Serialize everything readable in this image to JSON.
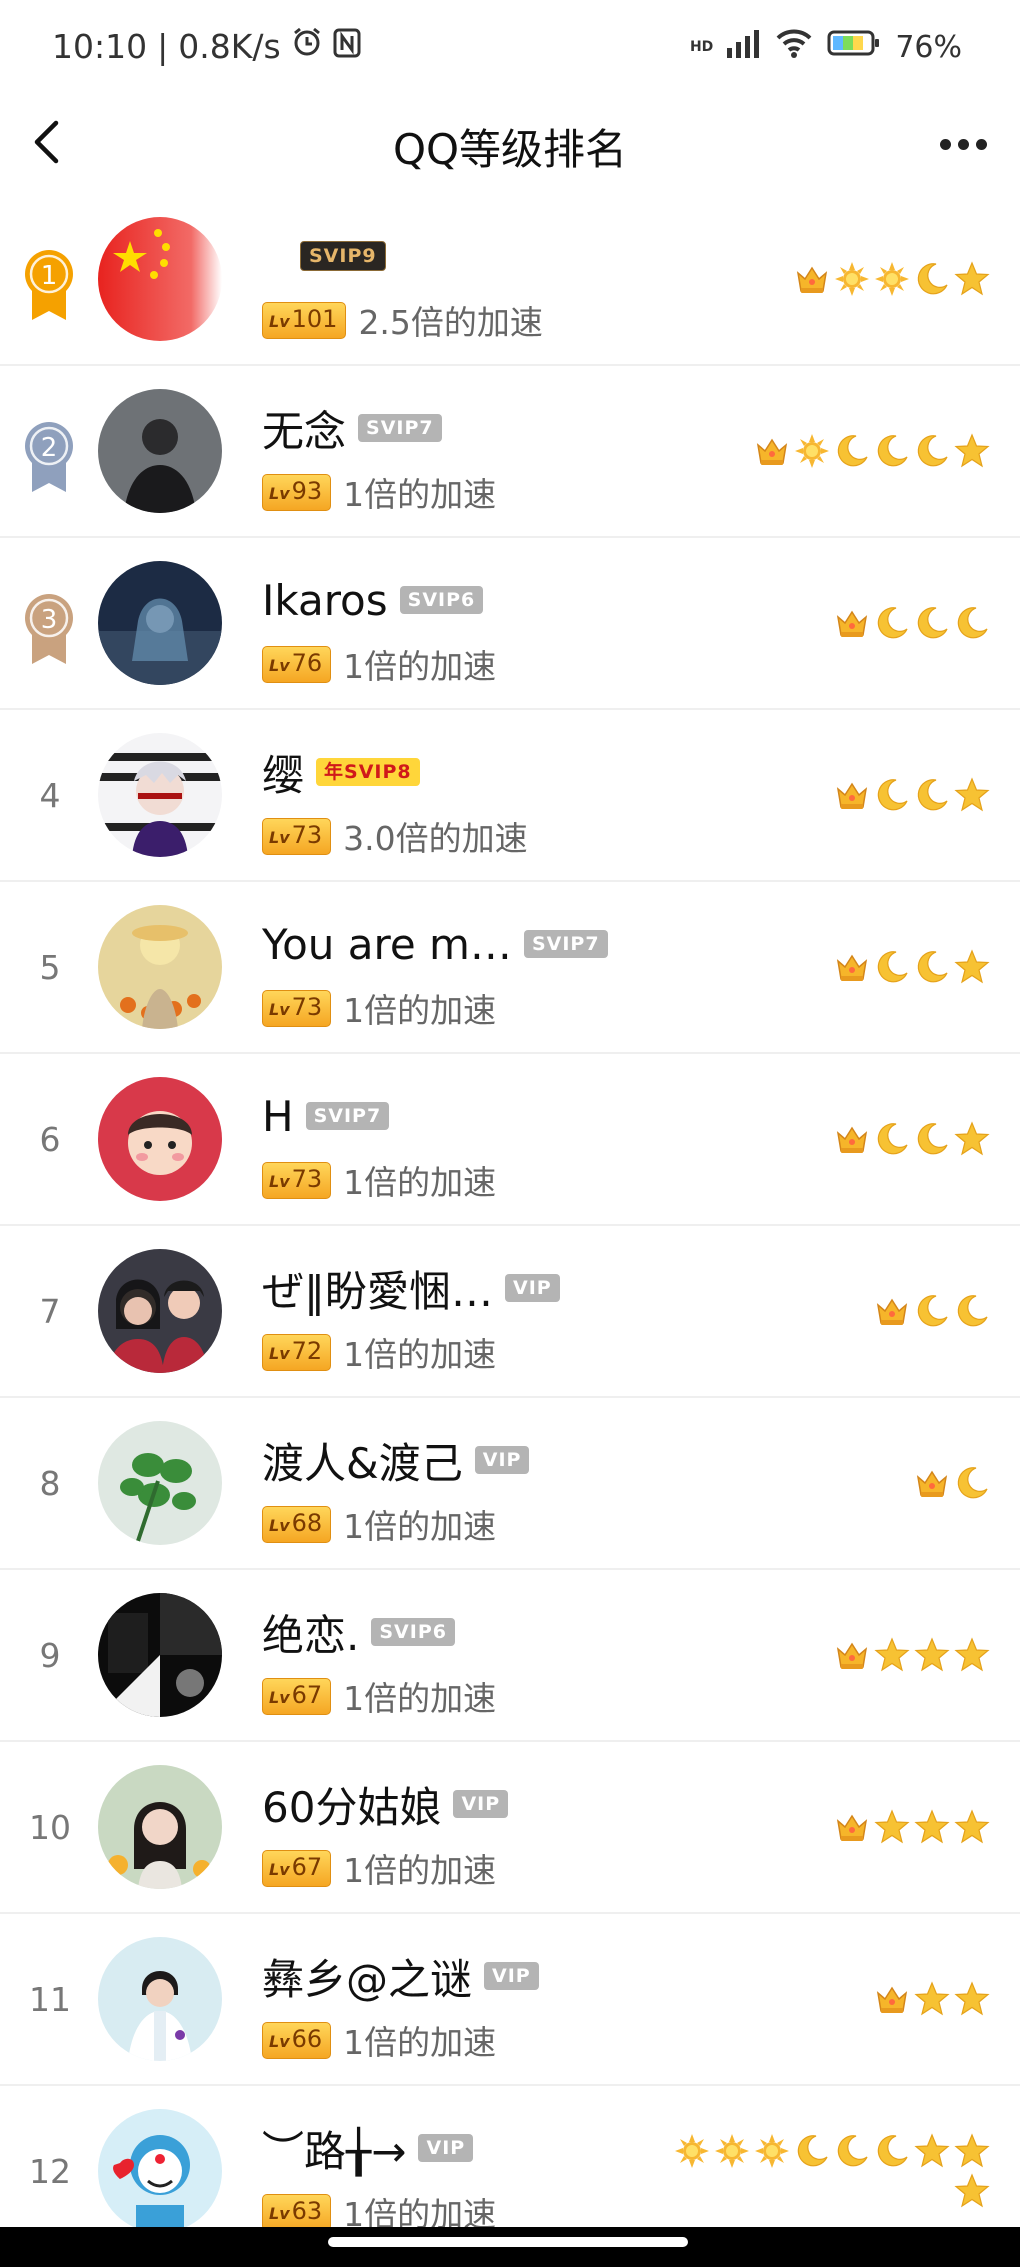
{
  "status_bar": {
    "time": "10:10",
    "separator": "|",
    "net_speed": "0.8K/s",
    "network_tag": "HD",
    "battery": "76%",
    "icons": [
      "alarm-icon",
      "nfc-icon",
      "signal-icon",
      "wifi-icon",
      "battery-icon"
    ]
  },
  "nav": {
    "back_icon": "chevron-left-icon",
    "title": "QQ等级排名",
    "more_icon": "more-dots-icon"
  },
  "colors": {
    "gold_medal": "#f5a100",
    "silver_medal": "#8fa0bd",
    "bronze_medal": "#c9a27f",
    "level_badge": "#f5b13a",
    "vip_grey": "#b4b4b4",
    "year_vip": "#ffd63a"
  },
  "rows": [
    {
      "rank": "1",
      "medal": "gold",
      "avatar": "china-flag-avatar",
      "name": "",
      "vip": "SVIP9",
      "vip_style": "dark",
      "level": "101",
      "speed": "2.5倍的加速",
      "level_icons": [
        "crown",
        "sun",
        "sun",
        "moon",
        "star"
      ]
    },
    {
      "rank": "2",
      "medal": "silver",
      "avatar": "person-avatar",
      "name": "无念",
      "vip": "SVIP7",
      "vip_style": "grey",
      "level": "93",
      "speed": "1倍的加速",
      "level_icons": [
        "crown",
        "sun",
        "moon",
        "moon",
        "moon",
        "star"
      ]
    },
    {
      "rank": "3",
      "medal": "bronze",
      "avatar": "anime-girl-avatar",
      "name": "Ikaros",
      "vip": "SVIP6",
      "vip_style": "grey",
      "level": "76",
      "speed": "1倍的加速",
      "level_icons": [
        "crown",
        "moon",
        "moon",
        "moon"
      ]
    },
    {
      "rank": "4",
      "medal": "",
      "avatar": "anime-boy-avatar",
      "name": "缨",
      "vip": "年SVIP8",
      "vip_style": "year",
      "level": "73",
      "speed": "3.0倍的加速",
      "level_icons": [
        "crown",
        "moon",
        "moon",
        "star"
      ]
    },
    {
      "rank": "5",
      "medal": "",
      "avatar": "flowers-avatar",
      "name": "You are m…",
      "vip": "SVIP7",
      "vip_style": "grey",
      "level": "73",
      "speed": "1倍的加速",
      "level_icons": [
        "crown",
        "moon",
        "moon",
        "star"
      ]
    },
    {
      "rank": "6",
      "medal": "",
      "avatar": "cartoon-kid-avatar",
      "name": "H",
      "vip": "SVIP7",
      "vip_style": "grey",
      "level": "73",
      "speed": "1倍的加速",
      "level_icons": [
        "crown",
        "moon",
        "moon",
        "star"
      ]
    },
    {
      "rank": "7",
      "medal": "",
      "avatar": "two-people-avatar",
      "name": "ぜ‖盼愛悃…",
      "vip": "VIP",
      "vip_style": "grey",
      "level": "72",
      "speed": "1倍的加速",
      "level_icons": [
        "crown",
        "moon",
        "moon"
      ]
    },
    {
      "rank": "8",
      "medal": "",
      "avatar": "clover-avatar",
      "name": "渡人&渡己",
      "vip": "VIP",
      "vip_style": "grey",
      "level": "68",
      "speed": "1倍的加速",
      "level_icons": [
        "crown",
        "moon"
      ]
    },
    {
      "rank": "9",
      "medal": "",
      "avatar": "dark-collage-avatar",
      "name": "绝恋.",
      "vip": "SVIP6",
      "vip_style": "grey",
      "level": "67",
      "speed": "1倍的加速",
      "level_icons": [
        "crown",
        "star",
        "star",
        "star"
      ]
    },
    {
      "rank": "10",
      "medal": "",
      "avatar": "girl-portrait-avatar",
      "name": "60分姑娘",
      "vip": "VIP",
      "vip_style": "grey",
      "level": "67",
      "speed": "1倍的加速",
      "level_icons": [
        "crown",
        "star",
        "star",
        "star"
      ]
    },
    {
      "rank": "11",
      "medal": "",
      "avatar": "nurse-avatar",
      "name": "彝乡@之谜",
      "vip": "VIP",
      "vip_style": "grey",
      "level": "66",
      "speed": "1倍的加速",
      "level_icons": [
        "crown",
        "star",
        "star"
      ]
    },
    {
      "rank": "12",
      "medal": "",
      "avatar": "doraemon-avatar",
      "name": "︶路╁→",
      "vip": "VIP",
      "vip_style": "grey",
      "level": "63",
      "speed": "1倍的加速",
      "level_icons": [
        "sun",
        "sun",
        "sun",
        "moon",
        "moon",
        "moon",
        "star",
        "star",
        "star"
      ]
    }
  ]
}
